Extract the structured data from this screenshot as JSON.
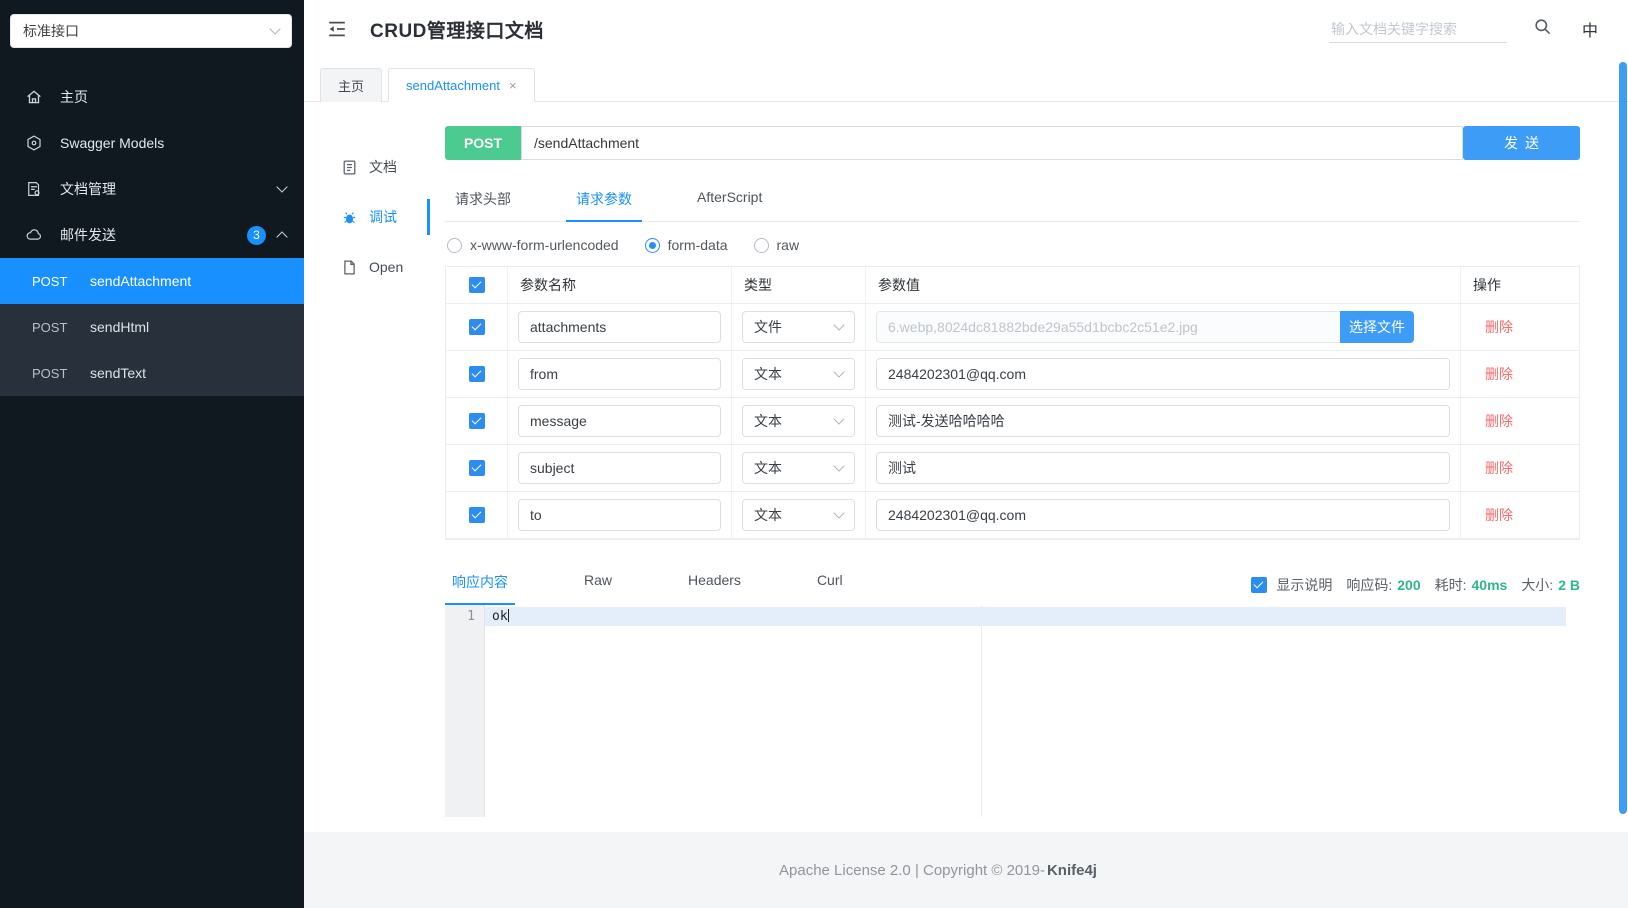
{
  "colors": {
    "accent": "#1890ff",
    "post_method_green": "#4bcb90",
    "button_blue": "#3d9cf6",
    "success_green": "#2eb886",
    "danger_red": "#f56c6c",
    "sidebar_bg": "#101820",
    "submenu_bg": "#28313b"
  },
  "sidebar": {
    "group_select": "标准接口",
    "items": [
      {
        "label": "主页"
      },
      {
        "label": "Swagger Models"
      },
      {
        "label": "文档管理"
      },
      {
        "label": "邮件发送",
        "badge": "3"
      }
    ],
    "submenu": [
      {
        "method": "POST",
        "name": "sendAttachment"
      },
      {
        "method": "POST",
        "name": "sendHtml"
      },
      {
        "method": "POST",
        "name": "sendText"
      }
    ]
  },
  "header": {
    "title": "CRUD管理接口文档",
    "search_placeholder": "输入文档关键字搜索",
    "lang": "中"
  },
  "tabs": {
    "home": "主页",
    "active": "sendAttachment",
    "close": "×"
  },
  "doc_nav": [
    {
      "label": "文档"
    },
    {
      "label": "调试"
    },
    {
      "label": "Open"
    }
  ],
  "request": {
    "method": "POST",
    "url": "/sendAttachment",
    "send_label": "发送",
    "tabs": [
      "请求头部",
      "请求参数",
      "AfterScript"
    ],
    "body_types": [
      "x-www-form-urlencoded",
      "form-data",
      "raw"
    ],
    "selected_body_type": "form-data",
    "table": {
      "headers": {
        "name": "参数名称",
        "type": "类型",
        "value": "参数值",
        "action": "操作"
      },
      "rows": [
        {
          "name": "attachments",
          "type": "文件",
          "value": "6.webp,8024dc81882bde29a55d1bcbc2c51e2.jpg",
          "file_button": "选择文件",
          "action": "删除"
        },
        {
          "name": "from",
          "type": "文本",
          "value": "2484202301@qq.com",
          "action": "删除"
        },
        {
          "name": "message",
          "type": "文本",
          "value": "测试-发送哈哈哈哈",
          "action": "删除"
        },
        {
          "name": "subject",
          "type": "文本",
          "value": "测试",
          "action": "删除"
        },
        {
          "name": "to",
          "type": "文本",
          "value": "2484202301@qq.com",
          "action": "删除"
        }
      ]
    }
  },
  "response": {
    "tabs": [
      "响应内容",
      "Raw",
      "Headers",
      "Curl"
    ],
    "show_desc_label": "显示说明",
    "status_label": "响应码:",
    "status_value": "200",
    "time_label": "耗时:",
    "time_value": "40ms",
    "size_label": "大小:",
    "size_value": "2 B",
    "editor": {
      "line_number": "1",
      "content": "ok"
    }
  },
  "footer": {
    "text": "Apache License 2.0 | Copyright © 2019-",
    "brand": "Knife4j"
  }
}
